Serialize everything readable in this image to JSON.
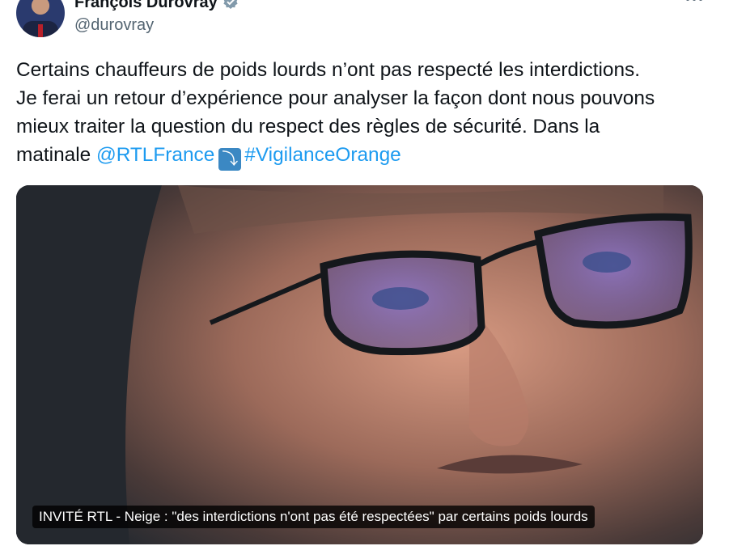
{
  "author": {
    "name": "François Durovray",
    "handle": "@durovray",
    "verified": true
  },
  "tweet": {
    "lines": [
      "Certains chauffeurs de poids lourds n’ont pas respecté les interdictions.",
      "Je ferai un retour d’expérience pour analyser la façon dont nous pouvons",
      "mieux traiter la question du respect des règles de sécurité. Dans la"
    ],
    "last_line_prefix": "matinale ",
    "mention": "@RTLFrance",
    "emoji": "⤵",
    "hashtag": "#VigilanceOrange"
  },
  "media": {
    "caption": "INVITÉ RTL - Neige : \"des interdictions n'ont pas été respectées\" par certains poids lourds"
  },
  "icons": {
    "more": "more-horizontal-icon",
    "verified": "verified-badge-icon",
    "emoji": "arrow-curving-down-emoji"
  },
  "colors": {
    "text": "#0f1419",
    "secondary": "#536471",
    "link": "#1d9bf0"
  }
}
